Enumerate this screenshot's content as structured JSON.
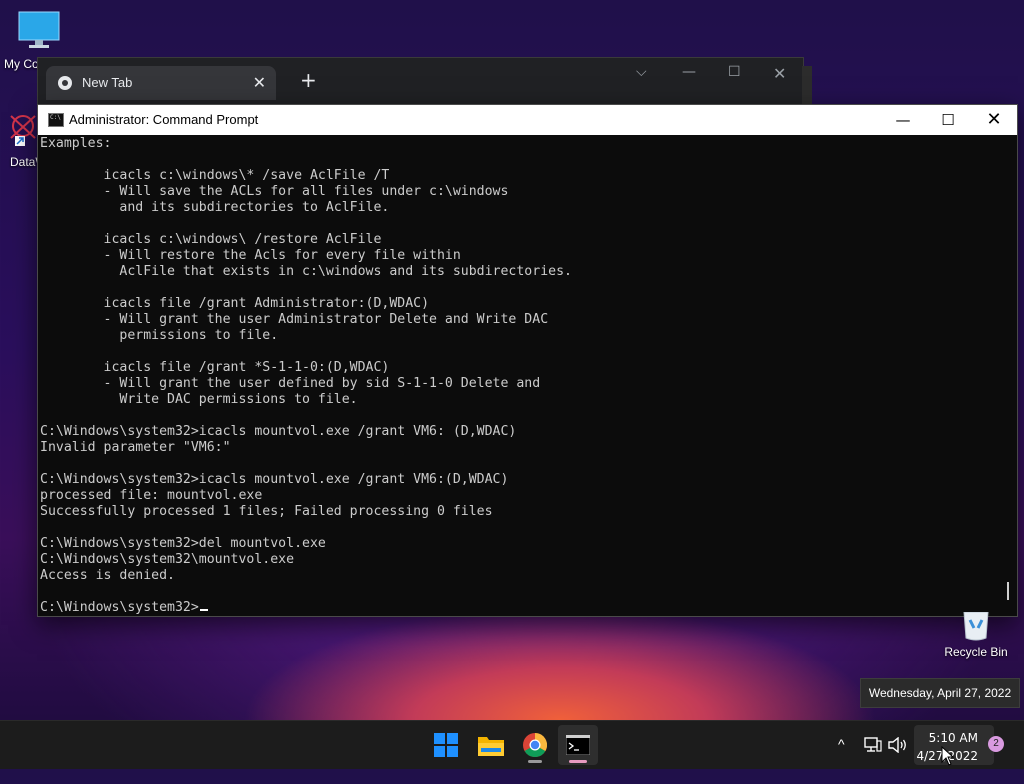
{
  "desktop": {
    "icons": [
      {
        "label": "My Co"
      },
      {
        "label": "DataW"
      }
    ],
    "recycle_bin": {
      "label": "Recycle Bin"
    }
  },
  "chrome": {
    "tab_title": "New Tab",
    "close_glyph": "✕",
    "new_tab_glyph": "+",
    "dropdown_glyph": "⌵",
    "min_glyph": "—",
    "max_glyph": "☐",
    "close_window_glyph": "✕"
  },
  "cmd": {
    "title": "Administrator: Command Prompt",
    "min_glyph": "—",
    "max_glyph": "☐",
    "close_glyph": "✕",
    "lines": [
      "Examples:",
      "",
      "        icacls c:\\windows\\* /save AclFile /T",
      "        - Will save the ACLs for all files under c:\\windows",
      "          and its subdirectories to AclFile.",
      "",
      "        icacls c:\\windows\\ /restore AclFile",
      "        - Will restore the Acls for every file within",
      "          AclFile that exists in c:\\windows and its subdirectories.",
      "",
      "        icacls file /grant Administrator:(D,WDAC)",
      "        - Will grant the user Administrator Delete and Write DAC",
      "          permissions to file.",
      "",
      "        icacls file /grant *S-1-1-0:(D,WDAC)",
      "        - Will grant the user defined by sid S-1-1-0 Delete and",
      "          Write DAC permissions to file.",
      "",
      "C:\\Windows\\system32>icacls mountvol.exe /grant VM6: (D,WDAC)",
      "Invalid parameter \"VM6:\"",
      "",
      "C:\\Windows\\system32>icacls mountvol.exe /grant VM6:(D,WDAC)",
      "processed file: mountvol.exe",
      "Successfully processed 1 files; Failed processing 0 files",
      "",
      "C:\\Windows\\system32>del mountvol.exe",
      "C:\\Windows\\system32\\mountvol.exe",
      "Access is denied.",
      ""
    ],
    "prompt": "C:\\Windows\\system32>"
  },
  "tooltip": {
    "text": "Wednesday, April 27, 2022"
  },
  "taskbar": {
    "apps": [
      {
        "name": "start",
        "icon": "windows-logo-icon"
      },
      {
        "name": "file-explorer",
        "icon": "folder-icon"
      },
      {
        "name": "chrome",
        "icon": "chrome-icon"
      },
      {
        "name": "terminal",
        "icon": "terminal-icon",
        "active": true
      }
    ],
    "tray": {
      "chevron": "^",
      "time": "5:10 AM",
      "date": "4/27/2022",
      "notifications": "2"
    }
  },
  "colors": {
    "terminal_bg": "#0c0c0c",
    "terminal_fg": "#cccccc",
    "taskbar_bg": "#1c1c1c",
    "accent": "#0078d4"
  }
}
